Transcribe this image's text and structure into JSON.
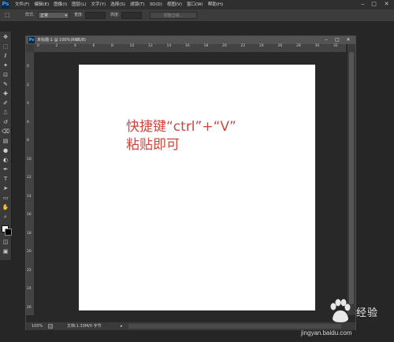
{
  "app": {
    "logo": "Ps"
  },
  "menubar": {
    "items": [
      "文件(F)",
      "编辑(E)",
      "图像(I)",
      "图层(L)",
      "文字(Y)",
      "选择(S)",
      "滤镜(T)",
      "3D(D)",
      "视图(V)",
      "窗口(W)",
      "帮助(H)"
    ],
    "window_controls": [
      "‒",
      "□",
      "✕"
    ]
  },
  "options": {
    "tool_glyph": "⬚",
    "style_label": "样式:",
    "style_value": "正常",
    "width_label": "宽度:",
    "height_label": "高度:",
    "refine_edge": "调整边缘..."
  },
  "toolbox": {
    "icons": [
      "move-icon",
      "marquee-icon",
      "lasso-icon",
      "magic-wand-icon",
      "crop-icon",
      "eyedropper-icon",
      "healing-brush-icon",
      "brush-icon",
      "clone-stamp-icon",
      "history-brush-icon",
      "eraser-icon",
      "gradient-icon",
      "blur-icon",
      "dodge-icon",
      "pen-icon",
      "type-icon",
      "path-select-icon",
      "shape-icon",
      "hand-icon",
      "zoom-icon"
    ],
    "glyphs": [
      "✥",
      "⬚",
      "ℓ",
      "✦",
      "⊡",
      "✎",
      "✚",
      "✐",
      "⎍",
      "↺",
      "⌫",
      "▤",
      "●",
      "◐",
      "✒",
      "T",
      "➤",
      "▭",
      "✋",
      "⌕"
    ]
  },
  "document": {
    "title": "未标题-1 @ 100%(RGB/8)",
    "close_tab": "×",
    "window_controls": [
      "‒",
      "□",
      "✕"
    ],
    "ruler_top": [
      "0",
      "2",
      "4",
      "6",
      "8",
      "10",
      "12",
      "14",
      "16",
      "18",
      "20",
      "22",
      "24",
      "26",
      "28",
      "30",
      "32"
    ],
    "ruler_left": [
      "0",
      "2",
      "4",
      "6",
      "8",
      "10",
      "12",
      "14",
      "16",
      "18",
      "20",
      "22",
      "24",
      "26"
    ],
    "canvas_text_line1": "快捷键“ctrl”+“V”",
    "canvas_text_line2": "粘贴即可",
    "canvas_text_color": "#d0463c"
  },
  "status": {
    "zoom": "100%",
    "doc_size": "文档:1.33M/0 字节",
    "arrow": "▸"
  },
  "watermark": {
    "brand": "经验",
    "url": "jingyan.baidu.com"
  }
}
